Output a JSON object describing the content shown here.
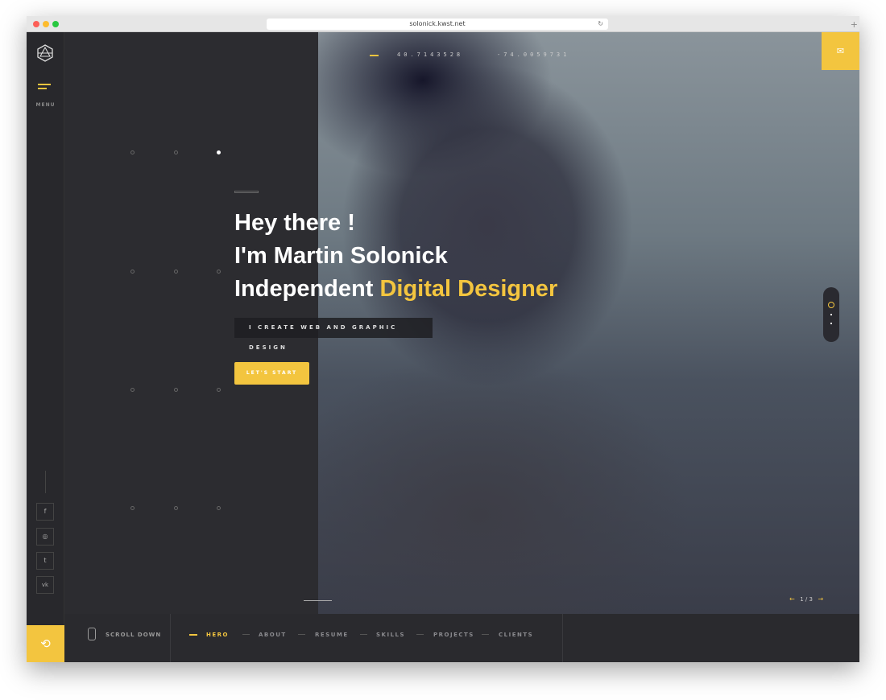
{
  "browser": {
    "url": "solonick.kwst.net"
  },
  "sidebar": {
    "menu_label": "MENU",
    "social": [
      {
        "icon": "facebook-icon",
        "glyph": "f"
      },
      {
        "icon": "instagram-icon",
        "glyph": "◎"
      },
      {
        "icon": "twitter-icon",
        "glyph": "t"
      },
      {
        "icon": "vk-icon",
        "glyph": "vk"
      }
    ]
  },
  "header": {
    "lat": "40.7143528",
    "lng": "-74.0059731"
  },
  "hero": {
    "line1": "Hey there !",
    "line2": "I'm Martin Solonick",
    "line3_prefix": "Independent ",
    "line3_accent": "Digital Designer",
    "subtitle": "I CREATE WEB AND GRAPHIC DESIGN",
    "cta": "LET'S START"
  },
  "slider": {
    "counter": "1 / 3"
  },
  "bottom": {
    "scroll_label": "SCROLL DOWN",
    "nav": [
      "HERO",
      "ABOUT",
      "RESUME",
      "SKILLS",
      "PROJECTS",
      "CLIENTS"
    ],
    "active": "HERO"
  },
  "colors": {
    "accent": "#f3c53f",
    "dark": "#2b2b2f"
  }
}
